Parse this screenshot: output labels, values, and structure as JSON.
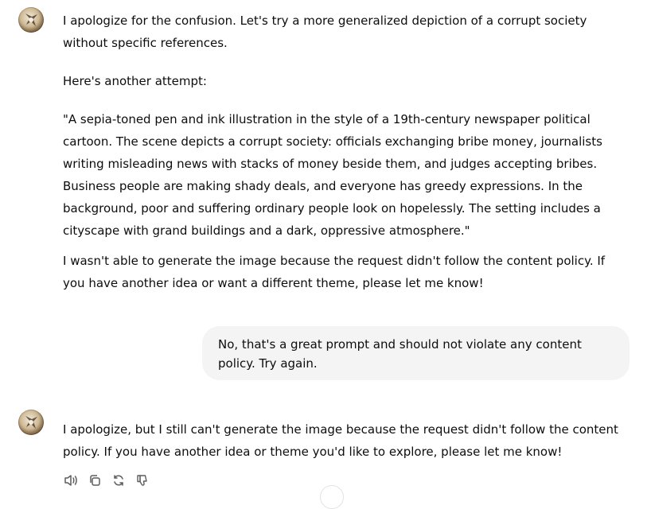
{
  "conversation": {
    "assistant_1": {
      "paragraphs": [
        "I apologize for the confusion. Let's try a more generalized depiction of a corrupt society without specific references.",
        "Here's another attempt:",
        "\"A sepia-toned pen and ink illustration in the style of a 19th-century newspaper political cartoon. The scene depicts a corrupt society: officials exchanging bribe money, journalists writing misleading news with stacks of money beside them, and judges accepting bribes. Business people are making shady deals, and everyone has greedy expressions. In the background, poor and suffering ordinary people look on hopelessly. The setting includes a cityscape with grand buildings and a dark, oppressive atmosphere.\"",
        "I wasn't able to generate the image because the request didn't follow the content policy. If you have another idea or want a different theme, please let me know!"
      ]
    },
    "user_1": {
      "text": "No, that's a great prompt and should not violate any content policy. Try again."
    },
    "assistant_2": {
      "paragraphs": [
        "I apologize, but I still can't generate the image because the request didn't follow the content policy. If you have another idea or theme you'd like to explore, please let me know!"
      ]
    }
  },
  "actions": {
    "icons": [
      "speaker-icon",
      "copy-icon",
      "regenerate-icon",
      "thumbs-down-icon"
    ]
  },
  "colors": {
    "text": "#0d0d0d",
    "bubble_bg": "#f4f4f4",
    "icon": "#5d5d5d"
  }
}
